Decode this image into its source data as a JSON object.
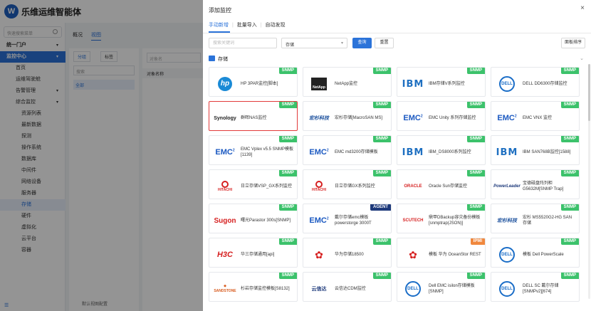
{
  "app": {
    "brand": "乐维运维智能体",
    "sidebar_search_placeholder": "快速搜索菜单",
    "nav": [
      {
        "label": "统一门户",
        "type": "top"
      },
      {
        "label": "监控中心",
        "type": "top-active"
      },
      {
        "label": "首页",
        "type": "sub"
      },
      {
        "label": "运维驾驶舱",
        "type": "sub"
      },
      {
        "label": "告警管理",
        "type": "sub-caret"
      },
      {
        "label": "综合监控",
        "type": "sub-caret"
      },
      {
        "label": "资源列表",
        "type": "subsub"
      },
      {
        "label": "最新数据",
        "type": "subsub"
      },
      {
        "label": "探测",
        "type": "subsub"
      },
      {
        "label": "操作系统",
        "type": "subsub"
      },
      {
        "label": "数据库",
        "type": "subsub"
      },
      {
        "label": "中间件",
        "type": "subsub"
      },
      {
        "label": "网络设备",
        "type": "subsub"
      },
      {
        "label": "服务器",
        "type": "subsub"
      },
      {
        "label": "存储",
        "type": "subsub-sel"
      },
      {
        "label": "硬件",
        "type": "subsub"
      },
      {
        "label": "虚拟化",
        "type": "subsub"
      },
      {
        "label": "云平台",
        "type": "subsub"
      },
      {
        "label": "容器",
        "type": "subsub"
      }
    ],
    "main_tabs": [
      "概况",
      "视图"
    ],
    "panel_tabs": [
      "分组",
      "标签"
    ],
    "panel_search_placeholder": "搜索",
    "panel_all": "全部",
    "panel_footer": "默认视图配置",
    "content_input_placeholder": "对象名",
    "content_header": "对象名称"
  },
  "drawer": {
    "title": "添加监控",
    "close": "×",
    "tabs": [
      "手动新增",
      "批量导入",
      "自动发现"
    ],
    "active_tab": 0,
    "keyword_placeholder": "搜索关键词",
    "category_value": "存储",
    "query_label": "查询",
    "reset_label": "重置",
    "sort_label": "面板排序",
    "section_title": "存储",
    "cards": [
      {
        "logo": "hp",
        "name": "HP 3PAR监控[脚本]",
        "badge": "SNMP",
        "badge_color": "green"
      },
      {
        "logo": "netapp",
        "name": "NetApp监控",
        "badge": "SNMP",
        "badge_color": "green"
      },
      {
        "logo": "ibm",
        "name": "IBM存储V系列监控",
        "badge": "SNMP",
        "badge_color": "green"
      },
      {
        "logo": "dell",
        "name": "DELL DD6300存储监控",
        "badge": "SNMP",
        "badge_color": "green"
      },
      {
        "logo": "synology",
        "name": "群晖NAS监控",
        "badge": "SNMP",
        "badge_color": "green",
        "highlight": true
      },
      {
        "logo": "macrosan",
        "name": "宏杉存储[MacroSAN MS]",
        "badge": "SNMP",
        "badge_color": "green"
      },
      {
        "logo": "emc",
        "name": "EMC Unity 系列存储监控",
        "badge": "SNMP",
        "badge_color": "green"
      },
      {
        "logo": "emc",
        "name": "EMC VNX 监控",
        "badge": "SNMP",
        "badge_color": "green"
      },
      {
        "logo": "emc",
        "name": "EMC Vplex v5.5 SNMP模板[1139]",
        "badge": "SNMP",
        "badge_color": "green"
      },
      {
        "logo": "emc",
        "name": "EMC md3200存储模板",
        "badge": "SNMP",
        "badge_color": "green"
      },
      {
        "logo": "ibm",
        "name": "IBM_DS8000系列监控",
        "badge": "SNMP",
        "badge_color": "green"
      },
      {
        "logo": "ibm",
        "name": "IBM SAN768B监控[1588]",
        "badge": "SNMP",
        "badge_color": "green"
      },
      {
        "logo": "hitachi",
        "name": "日立存储VSP_GX系列监控",
        "badge": "SNMP",
        "badge_color": "green"
      },
      {
        "logo": "hitachi",
        "name": "日立存储GX系列监控",
        "badge": "SNMP",
        "badge_color": "green"
      },
      {
        "logo": "oracle",
        "name": "Oracle Sun存储监控",
        "badge": "SNMP",
        "badge_color": "green"
      },
      {
        "logo": "powerleader",
        "name": "宝德磁盘阵列柜 G5632M[SNMP Trap]",
        "badge": "SNMP",
        "badge_color": "green"
      },
      {
        "logo": "sugon",
        "name": "曙光Parastor 300s[SNMP]",
        "badge": "SNMP",
        "badge_color": "green"
      },
      {
        "logo": "emc",
        "name": "戴尔存储emc模板 powerstorge 3000T",
        "badge": "AGENT",
        "badge_color": "navy"
      },
      {
        "logo": "scutech",
        "name": "鼎甲DBackup容灾备份模板[snmptrap(JSON)]",
        "badge": "SNMP",
        "badge_color": "green"
      },
      {
        "logo": "macrosan",
        "name": "宏杉 MS5520G2-HG SAN 存储",
        "badge": "SNMP",
        "badge_color": "green"
      },
      {
        "logo": "h3c",
        "name": "华三存储通用[api]",
        "badge": "SNMP",
        "badge_color": "green"
      },
      {
        "logo": "huawei",
        "name": "华为存储18500",
        "badge": "SNMP",
        "badge_color": "green"
      },
      {
        "logo": "huawei",
        "name": "模板 华为 OceanStor REST",
        "badge": "IPMI",
        "badge_color": "orange"
      },
      {
        "logo": "dell",
        "name": "模板 Dell PowerScale",
        "badge": "SNMP",
        "badge_color": "green"
      },
      {
        "logo": "sandstone",
        "name": "杉岩存储监控模板[S8132]",
        "badge": "SNMP",
        "badge_color": "green"
      },
      {
        "logo": "yunzhi",
        "name": "云信达CDM监控",
        "badge": "SNMP",
        "badge_color": "green"
      },
      {
        "logo": "dell",
        "name": "Dell EMC isilon存储模板[SNMP]",
        "badge": "SNMP",
        "badge_color": "green"
      },
      {
        "logo": "dell",
        "name": "DELL SC 戴尔存储 [SNMPv2][674]",
        "badge": "SNMP",
        "badge_color": "green"
      }
    ]
  },
  "logos": {
    "hp": "hp",
    "netapp": "NetApp",
    "ibm": "IBM",
    "dell": "DELL",
    "synology": "Synology",
    "macrosan": "宏杉科技",
    "emc": "EMC",
    "hitachi": "HITACHI",
    "oracle": "ORACLE",
    "powerleader": "PowerLeader",
    "sugon": "Sugon",
    "scutech": "SCUTECH",
    "h3c": "H3C",
    "huawei": "HUAWEI",
    "sandstone": "SANDSTONE",
    "yunzhi": "云信达"
  },
  "colors": {
    "accent": "#2b73d9",
    "badge_green": "#3cc26b",
    "badge_navy": "#1e3a7b",
    "badge_orange": "#f0883e",
    "highlight": "#e23b3b"
  }
}
